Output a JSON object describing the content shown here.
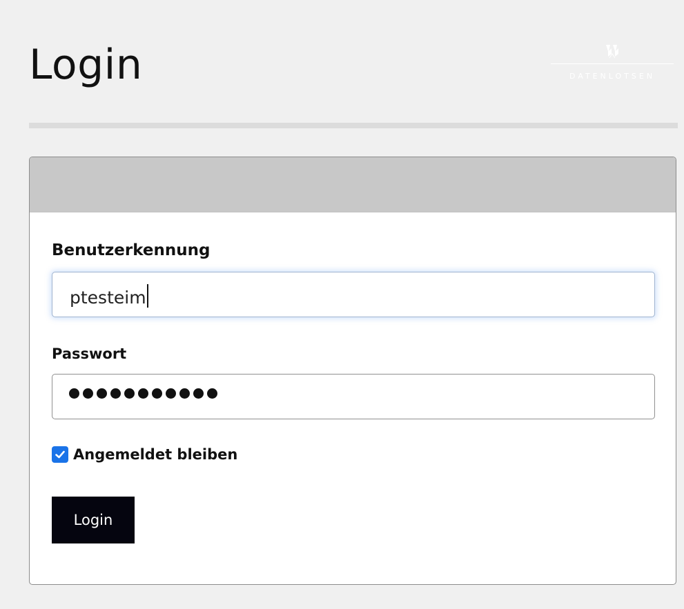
{
  "header": {
    "title": "Login",
    "logo_text": "DATENLOTSEN"
  },
  "form": {
    "username_label": "Benutzerkennung",
    "username_value": "ptesteim",
    "password_label": "Passwort",
    "password_mask_length": 11,
    "remember_label": "Angemeldet bleiben",
    "remember_checked": true,
    "submit_label": "Login"
  },
  "colors": {
    "background": "#f0f0f0",
    "card_header": "#c8c8c8",
    "button": "#05050f",
    "checkbox_accent": "#1a73e8"
  },
  "icons": {
    "logo": "datenlotsen-logo-icon",
    "checkbox": "checkmark-icon"
  }
}
